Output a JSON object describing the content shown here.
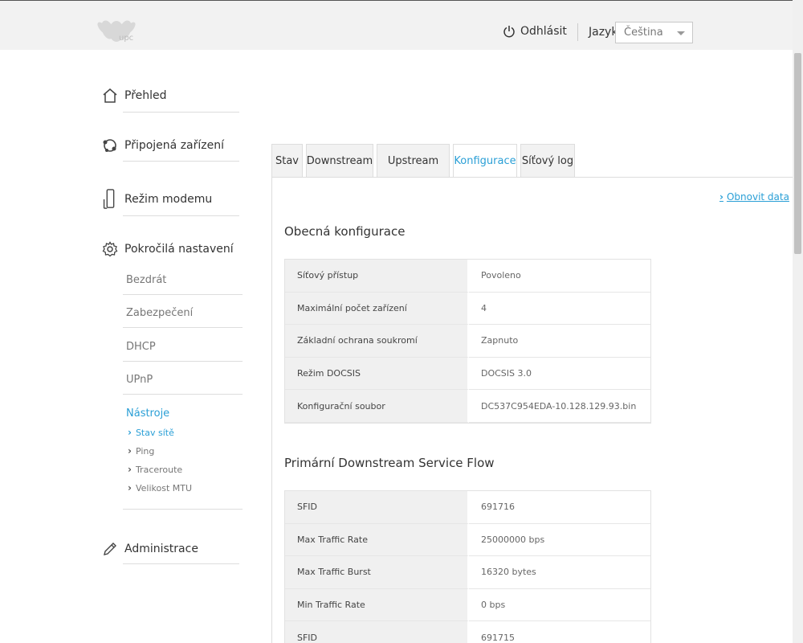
{
  "header": {
    "logo_text": "upc",
    "logout_label": "Odhlásit",
    "language_label": "Jazyk",
    "language_value": "Čeština"
  },
  "sidebar": {
    "overview": "Přehled",
    "connected_devices": "Připojená zařízení",
    "modem_mode": "Režim modemu",
    "advanced": "Pokročilá nastavení",
    "advanced_items": [
      "Bezdrát",
      "Zabezpečení",
      "DHCP",
      "UPnP",
      "Nástroje"
    ],
    "tools_items": [
      "Stav sítě",
      "Ping",
      "Traceroute",
      "Velikost MTU"
    ],
    "administration": "Administrace"
  },
  "tabs": [
    "Stav",
    "Downstream",
    "Upstream",
    "Konfigurace",
    "Síťový log"
  ],
  "active_tab": "Konfigurace",
  "refresh_label": "Obnovit data",
  "general": {
    "title": "Obecná konfigurace",
    "rows": [
      {
        "key": "Síťový přístup",
        "value": "Povoleno"
      },
      {
        "key": "Maximální počet zařízení",
        "value": "4"
      },
      {
        "key": "Základní ochrana soukromí",
        "value": "Zapnuto"
      },
      {
        "key": "Režim DOCSIS",
        "value": "DOCSIS 3.0"
      },
      {
        "key": "Konfigurační soubor",
        "value": "DC537C954EDA-10.128.129.93.bin"
      }
    ]
  },
  "downstream": {
    "title": "Primární Downstream Service Flow",
    "rows": [
      {
        "key": "SFID",
        "value": "691716"
      },
      {
        "key": "Max Traffic Rate",
        "value": "25000000 bps"
      },
      {
        "key": "Max Traffic Burst",
        "value": "16320 bytes"
      },
      {
        "key": "Min Traffic Rate",
        "value": "0 bps"
      },
      {
        "key": "SFID",
        "value": "691715"
      }
    ]
  },
  "colors": {
    "accent": "#2a9fd6",
    "header_bg": "#f2f2f2"
  }
}
